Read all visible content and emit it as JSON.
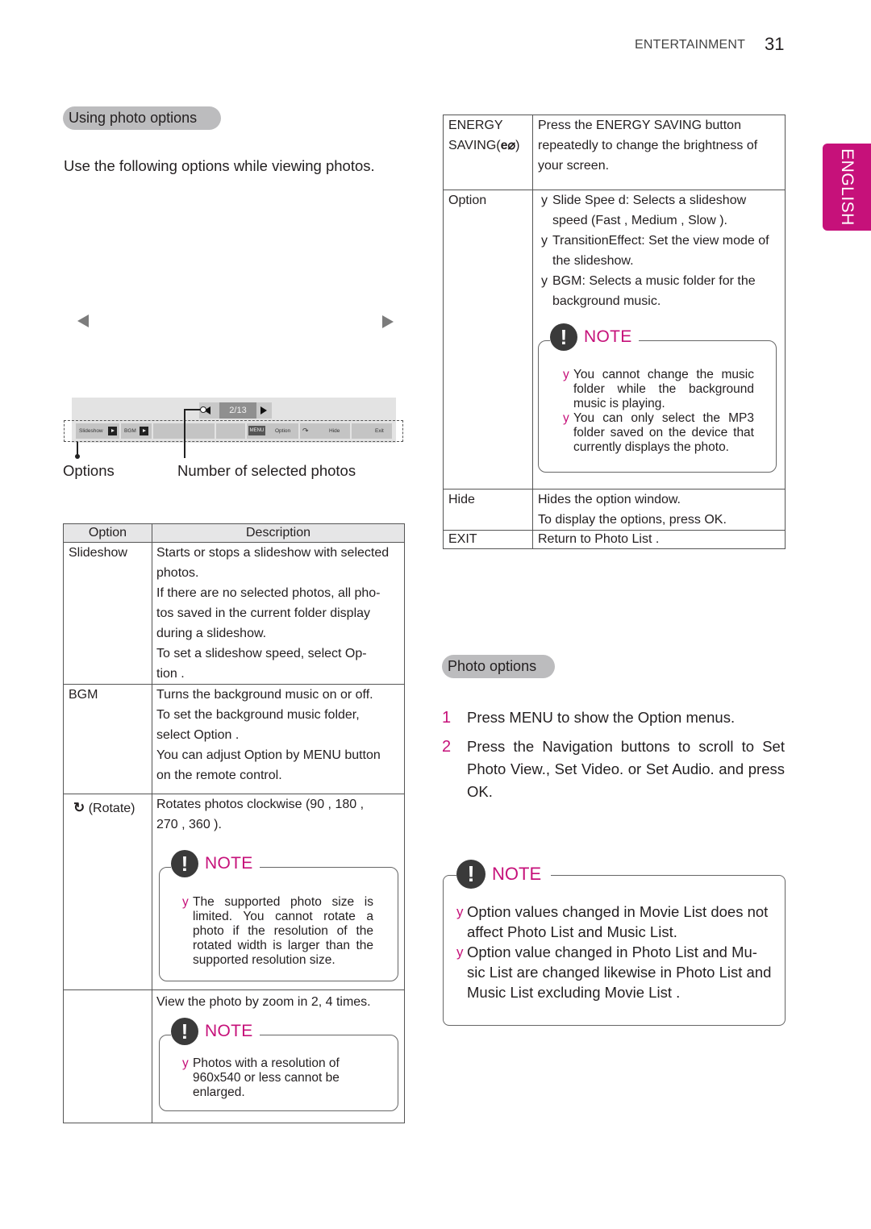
{
  "header": {
    "section": "ENTERTAINMENT",
    "page_number": "31"
  },
  "language_tab": "ENGLISH",
  "left": {
    "section_title": "Using photo options",
    "intro": "Use the following options while viewing photos.",
    "illustration": {
      "prev_icon": "left-arrow-icon",
      "next_icon": "right-arrow-icon",
      "counter": "2/13",
      "osd_buttons": [
        "Slideshow",
        "BGM",
        "",
        "",
        "",
        "Option",
        "Hide",
        "Exit"
      ],
      "menu_key": "MENU",
      "callout_options": "Options",
      "callout_count": "Number of selected photos"
    },
    "table": {
      "headers": [
        "Option",
        "Description"
      ],
      "rows": [
        {
          "option": "Slideshow",
          "lines": [
            "Starts or stops a slideshow with selected",
            "photos.",
            "If there are no selected photos, all pho-",
            "tos saved in the current folder display",
            "during a slideshow.",
            "To set a slideshow speed, select Op-",
            "tion ."
          ]
        },
        {
          "option": "BGM",
          "lines": [
            "Turns the background music on or off.",
            "To set the background music folder,",
            "select Option .",
            "You can adjust Option by MENU button",
            "on the remote control."
          ]
        },
        {
          "option": "(Rotate)",
          "icon": "rotate-icon",
          "lines": [
            "Rotates photos clockwise (90 , 180 ,",
            "270 , 360 )."
          ],
          "note": {
            "title": "NOTE",
            "items": [
              "The supported photo size is limited. You cannot rotate a photo if the resolution of the rotated width is larger than the supported resolution size."
            ]
          }
        },
        {
          "option": "",
          "lines": [
            "View the photo by zoom in 2, 4 times."
          ],
          "note": {
            "title": "NOTE",
            "items": [
              "Photos with a resolution of 960x540 or less cannot be enlarged."
            ]
          }
        }
      ]
    }
  },
  "right": {
    "table": {
      "rows": [
        {
          "option_line1": "ENERGY",
          "option_line2": "SAVING(",
          "option_icon": "energy-saving-icon",
          "option_line2_end": ")",
          "lines": [
            "Press the ENERGY SAVING button",
            "repeatedly to change the brightness of",
            "your screen."
          ]
        },
        {
          "option": "Option",
          "bullets": [
            "Slide Spee d: Selects a slideshow speed (Fast , Medium , Slow ).",
            "TransitionEffect:   Set the view mode of the slideshow.",
            "BGM: Selects a music folder for the background music."
          ],
          "note": {
            "title": "NOTE",
            "items": [
              "You cannot change the music folder while the background music is playing.",
              "You can only select the MP3 folder saved on the device that currently displays the photo."
            ]
          }
        },
        {
          "option": "Hide",
          "lines": [
            "Hides the option window.",
            "To display the options, press OK."
          ]
        },
        {
          "option": "EXIT",
          "lines": [
            "Return to Photo List  ."
          ]
        }
      ]
    },
    "section_title": "Photo options",
    "steps": [
      {
        "num": "1",
        "text": "Press MENU to show the Option  menus."
      },
      {
        "num": "2",
        "text": "Press the Navigation buttons to scroll to Set Photo View., Set Video. or Set Audio. and press OK."
      }
    ],
    "note": {
      "title": "NOTE",
      "items": [
        "Option values changed in Movie List  does not affect Photo List  and Music List.",
        "Option value changed in Photo List  and Mu-sic List  are changed likewise in Photo List and Music List  excluding Movie List ."
      ]
    }
  },
  "bullet_glyph": "y",
  "colors": {
    "accent": "#c6117a",
    "pill": "#bcbcbe",
    "header_row": "#e6e6e7"
  }
}
